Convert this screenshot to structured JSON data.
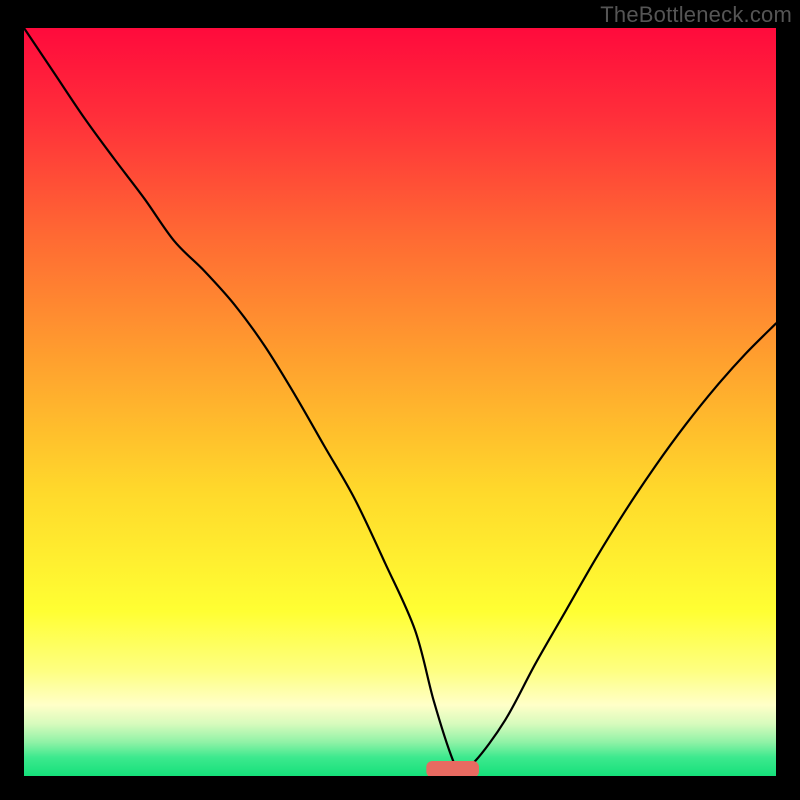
{
  "watermark": "TheBottleneck.com",
  "colors": {
    "page_bg": "#000000",
    "watermark": "#555555",
    "curve": "#000000",
    "marker_fill": "#e86a61",
    "gradient_stops": [
      {
        "offset": 0.0,
        "color": "#ff0a3c"
      },
      {
        "offset": 0.12,
        "color": "#ff2f3a"
      },
      {
        "offset": 0.28,
        "color": "#ff6a33"
      },
      {
        "offset": 0.45,
        "color": "#ffa22e"
      },
      {
        "offset": 0.62,
        "color": "#ffd92b"
      },
      {
        "offset": 0.78,
        "color": "#ffff33"
      },
      {
        "offset": 0.86,
        "color": "#feff82"
      },
      {
        "offset": 0.905,
        "color": "#ffffc8"
      },
      {
        "offset": 0.93,
        "color": "#d8fbbd"
      },
      {
        "offset": 0.955,
        "color": "#8ff2a6"
      },
      {
        "offset": 0.975,
        "color": "#3de98e"
      },
      {
        "offset": 1.0,
        "color": "#15e07a"
      }
    ]
  },
  "chart_data": {
    "type": "line",
    "title": "",
    "xlabel": "",
    "ylabel": "",
    "xlim": [
      0,
      100
    ],
    "ylim": [
      0,
      100
    ],
    "grid": false,
    "legend": false,
    "series": [
      {
        "name": "bottleneck-curve",
        "x": [
          0,
          4,
          8,
          12,
          16,
          20,
          24,
          28,
          32,
          36,
          40,
          44,
          48,
          52,
          54.5,
          57,
          58,
          60,
          64,
          68,
          72,
          76,
          80,
          84,
          88,
          92,
          96,
          100
        ],
        "values": [
          100,
          94,
          88,
          82.5,
          77.2,
          71.5,
          67.5,
          63,
          57.5,
          51,
          44,
          37,
          28.5,
          19.5,
          10,
          2.2,
          1.0,
          2.0,
          7.5,
          15,
          22,
          29,
          35.5,
          41.5,
          47,
          52,
          56.5,
          60.5
        ]
      }
    ],
    "marker": {
      "name": "optimum-marker",
      "x_center": 57,
      "y": 0.9,
      "width": 7,
      "height": 2.2
    }
  }
}
